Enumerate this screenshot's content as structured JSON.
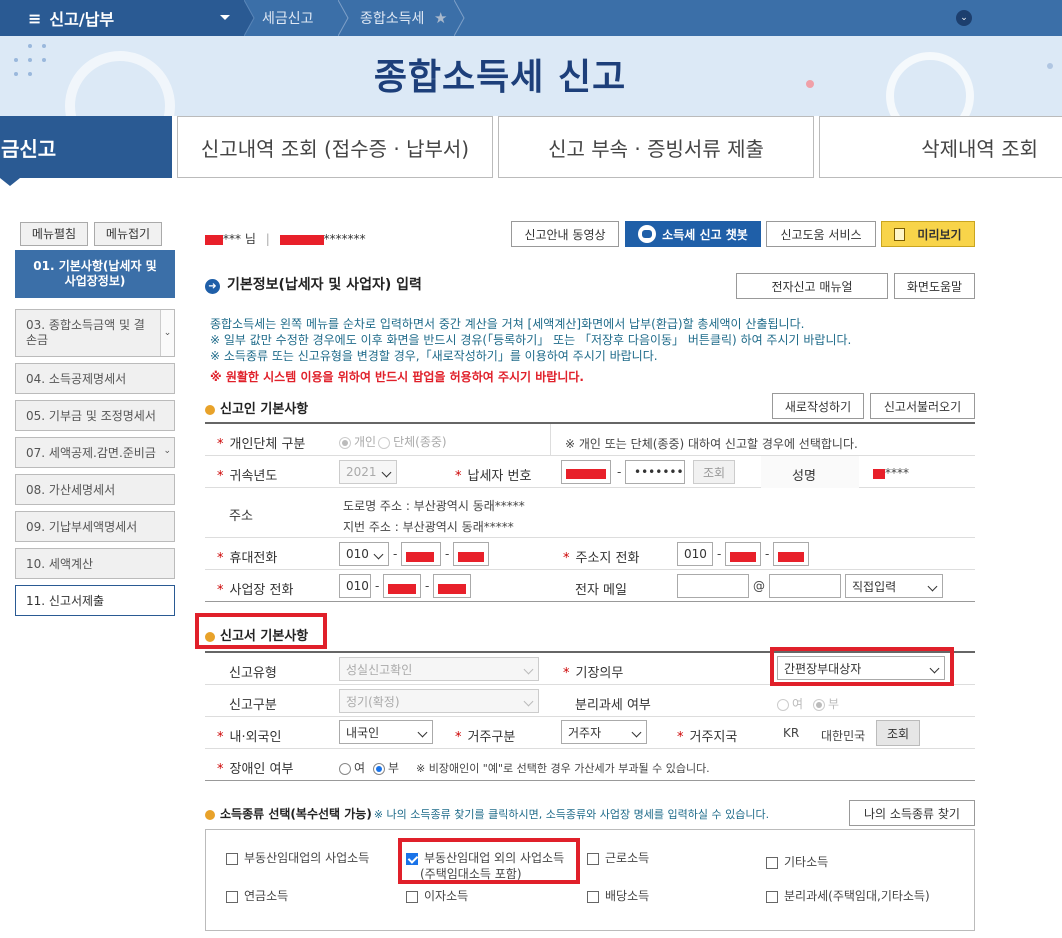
{
  "topbar": {
    "menu_title": "신고/납부",
    "crumb1": "세금신고",
    "crumb2": "종합소득세"
  },
  "banner": {
    "title": "종합소득세 신고"
  },
  "tabs": [
    "금신고",
    "신고내역 조회 (접수증 · 납부서)",
    "신고 부속 · 증빙서류 제출",
    "삭제내역 조회"
  ],
  "sidebar": {
    "expand": "메뉴펼침",
    "collapse": "메뉴접기",
    "items": [
      "01. 기본사항(납세자 및 사업장정보)",
      "03. 종합소득금액 및 결손금",
      "04. 소득공제명세서",
      "05. 기부금 및 조정명세서",
      "07. 세액공제.감면.준비금",
      "08. 가산세명세서",
      "09. 기납부세액명세서",
      "10. 세액계산",
      "11. 신고서제출"
    ]
  },
  "user": {
    "name_suffix": "*** 님",
    "masked_id": "*******"
  },
  "toolbar": {
    "video": "신고안내 동영상",
    "chatbot": "소득세 신고 챗봇",
    "help_service": "신고도움 서비스",
    "preview": "미리보기"
  },
  "section_main": {
    "title": "기본정보(납세자 및 사업자) 입력",
    "manual": "전자신고 매뉴얼",
    "screen_help": "화면도움말"
  },
  "notice": [
    "종합소득세는 왼쪽 메뉴를 순차로 입력하면서 중간 계산을 거쳐 [세액계산]화면에서 납부(환급)할 총세액이 산출됩니다.",
    "※ 일부 값만 수정한 경우에도 이후 화면을 반드시 경유(「등록하기」 또는 「저장후 다음이동」 버튼클릭) 하여 주시기 바랍니다.",
    "※ 소득종류 또는 신고유형을 변경할 경우,「새로작성하기」를 이용하여 주시기 바랍니다.",
    "※ 원활한 시스템 이용을 위하여 반드시 팝업을 허용하여 주시기 바랍니다."
  ],
  "reporter": {
    "title": "신고인 기본사항",
    "new": "새로작성하기",
    "load": "신고서불러오기",
    "type_label": "개인단체 구분",
    "type_opt1": "개인",
    "type_opt2": "단체(종중)",
    "type_note": "※ 개인 또는 단체(종중) 대하여 신고할 경우에 선택합니다.",
    "year_label": "귀속년도",
    "year": "2021",
    "taxid_label": "납세자 번호",
    "taxid_mask": "•••••••",
    "lookup": "조회",
    "name_label": "성명",
    "name_mask": "****",
    "addr_label": "주소",
    "road_addr": "도로명 주소 :   부산광역시 동래*****",
    "lot_addr": "지번 주소 :   부산광역시 동래*****",
    "mobile_label": "휴대전화",
    "mobile_prefix": "010",
    "home_label": "주소지 전화",
    "home_prefix": "010",
    "biz_label": "사업장 전화",
    "biz_prefix": "010",
    "email_label": "전자 메일",
    "email_at": "@",
    "email_domain": "직접입력",
    "dash": "-"
  },
  "basic": {
    "title": "신고서 기본사항",
    "rtype_label": "신고유형",
    "rtype": "성실신고확인",
    "bookkeeping_label": "기장의무",
    "bookkeeping": "간편장부대상자",
    "rkind_label": "신고구분",
    "rkind": "정기(확정)",
    "separate_label": "분리과세 여부",
    "yes": "여",
    "no": "부",
    "nationality_label": "내·외국인",
    "nationality": "내국인",
    "residence_label": "거주구분",
    "residence": "거주자",
    "region_label": "거주지국",
    "region_code": "KR",
    "region_name": "대한민국",
    "lookup": "조회",
    "disabled_label": "장애인 여부",
    "disabled_note": "※ 비장애인이 \"예\"로 선택한 경우 가산세가 부과될 수 있습니다."
  },
  "income": {
    "title": "소득종류 선택(복수선택 가능)",
    "note": "※ 나의 소득종류 찾기를 클릭하시면, 소득종류와 사업장 명세를 입력하실 수 있습니다.",
    "find": "나의 소득종류 찾기",
    "types": [
      "부동산임대업의 사업소득",
      "부동산임대업 외의 사업소득",
      "(주택임대소득 포함)",
      "근로소득",
      "기타소득",
      "연금소득",
      "이자소득",
      "배당소득",
      "분리과세(주택임대,기타소득)"
    ]
  },
  "colors": {
    "accent": "#2a5a93",
    "highlight": "#e0202a"
  }
}
